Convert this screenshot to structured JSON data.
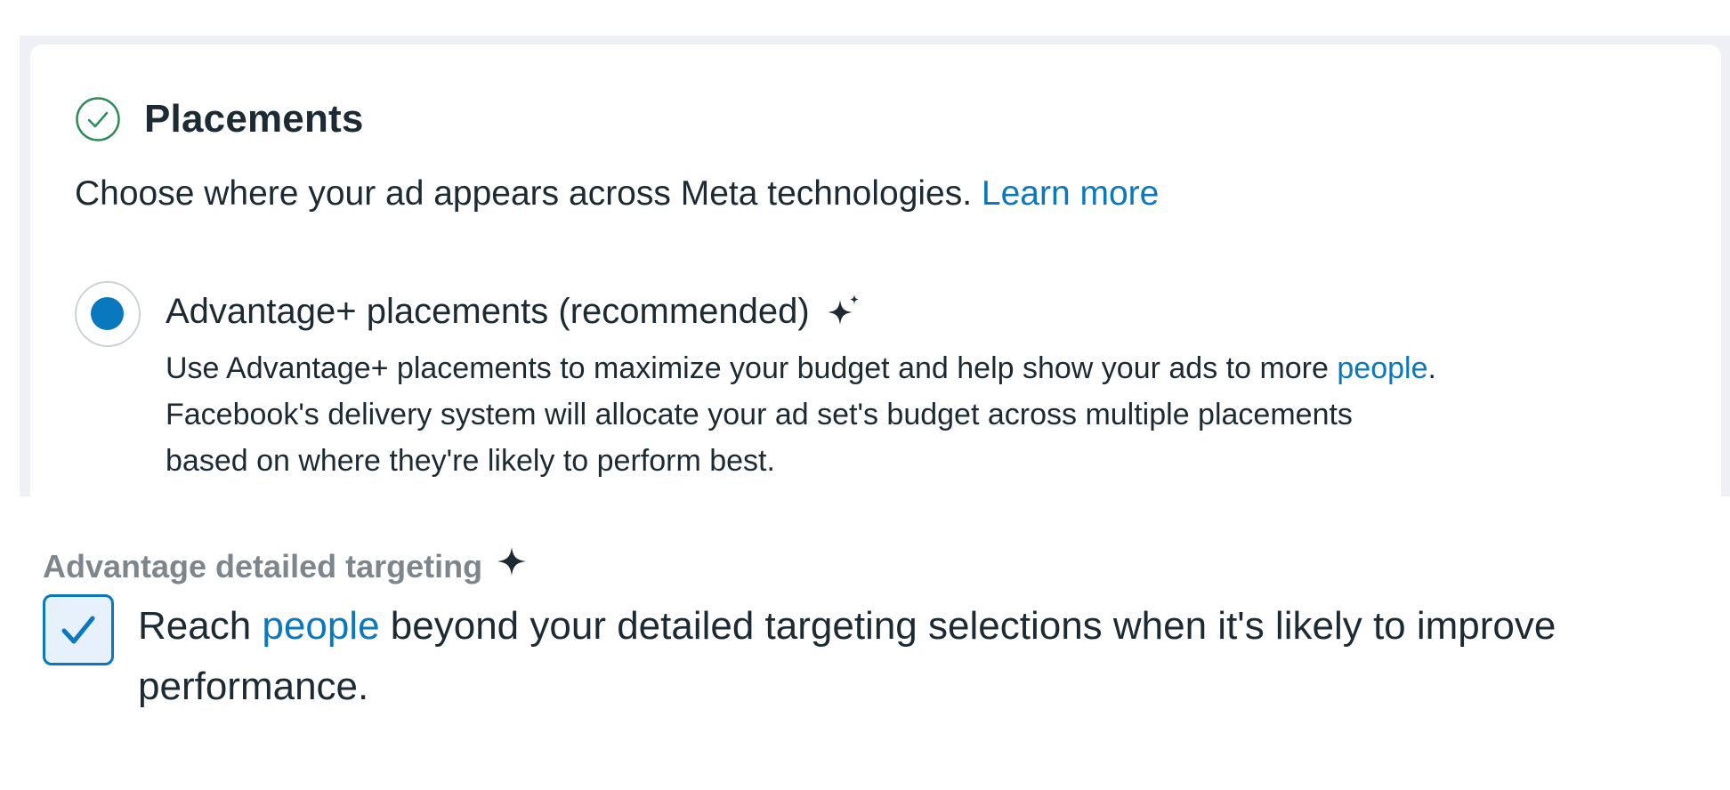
{
  "placements": {
    "title": "Placements",
    "subtitle": "Choose where your ad appears across Meta technologies.",
    "learn_more": "Learn more",
    "option": {
      "label": "Advantage+ placements (recommended)",
      "selected": true,
      "desc_line1_prefix": "Use Advantage+ placements to maximize your budget and help show your ads to more",
      "desc_line1_link": "people",
      "desc_line1_suffix": ".",
      "desc_line2": "Facebook's delivery system will allocate your ad set's budget across multiple placements",
      "desc_line3": "based on where they're likely to perform best."
    }
  },
  "detailed_targeting": {
    "label": "Advantage detailed targeting",
    "checked": true,
    "text_prefix": "Reach",
    "text_link": "people",
    "text_suffix": "beyond your detailed targeting selections when it's likely to improve",
    "text_line2": "performance."
  },
  "colors": {
    "accent": "#0a78be",
    "success": "#2e8b57",
    "text": "#1c2b33",
    "muted_label": "#7d868c"
  },
  "icons": [
    "check-circle-icon",
    "sparkle-icon",
    "checkmark-icon"
  ]
}
